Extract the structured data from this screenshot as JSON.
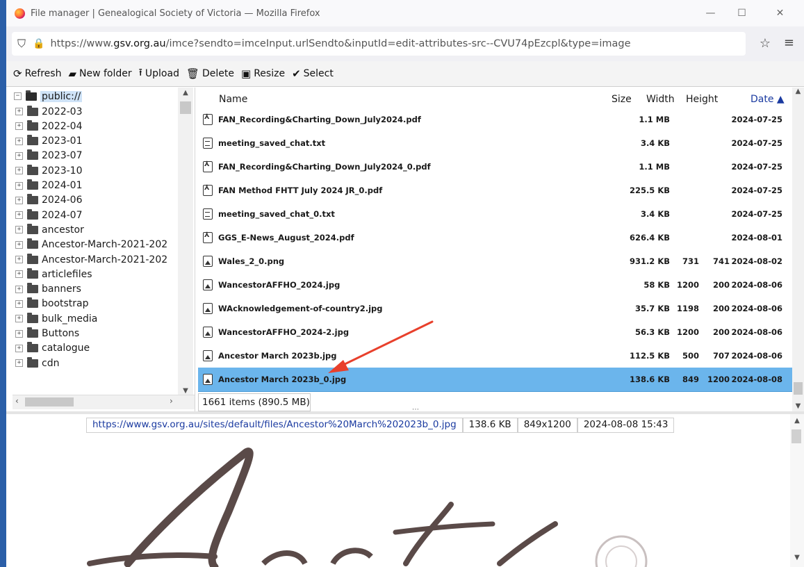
{
  "window": {
    "title": "File manager | Genealogical Society of Victoria — Mozilla Firefox",
    "controls": [
      "—",
      "☐",
      "✕"
    ]
  },
  "urlbar": {
    "url_prefix": "https://www.",
    "url_host": "gsv.org.au",
    "url_rest": "/imce?sendto=imceInput.urlSendto&inputId=edit-attributes-src--CVU74pEzcpl&type=image"
  },
  "toolbar": {
    "refresh": "Refresh",
    "new_folder": "New folder",
    "upload": "Upload",
    "delete": "Delete",
    "resize": "Resize",
    "select": "Select"
  },
  "tree": {
    "root": "public://",
    "folders": [
      "2022-03",
      "2022-04",
      "2023-01",
      "2023-07",
      "2023-10",
      "2024-01",
      "2024-06",
      "2024-07",
      "ancestor",
      "Ancestor-March-2021-202",
      "Ancestor-March-2021-202",
      "articlefiles",
      "banners",
      "bootstrap",
      "bulk_media",
      "Buttons",
      "catalogue",
      "cdn"
    ]
  },
  "list": {
    "headers": {
      "name": "Name",
      "size": "Size",
      "width": "Width",
      "height": "Height",
      "date": "Date ▲"
    },
    "files": [
      {
        "name": "FAN_Recording&Charting_Down_July2024.pdf",
        "size": "1.1 MB",
        "width": "",
        "height": "",
        "date": "2024-07-25",
        "type": "pdf"
      },
      {
        "name": "meeting_saved_chat.txt",
        "size": "3.4 KB",
        "width": "",
        "height": "",
        "date": "2024-07-25",
        "type": "txt"
      },
      {
        "name": "FAN_Recording&Charting_Down_July2024_0.pdf",
        "size": "1.1 MB",
        "width": "",
        "height": "",
        "date": "2024-07-25",
        "type": "pdf"
      },
      {
        "name": "FAN Method FHTT July 2024 JR_0.pdf",
        "size": "225.5 KB",
        "width": "",
        "height": "",
        "date": "2024-07-25",
        "type": "pdf"
      },
      {
        "name": "meeting_saved_chat_0.txt",
        "size": "3.4 KB",
        "width": "",
        "height": "",
        "date": "2024-07-25",
        "type": "txt"
      },
      {
        "name": "GGS_E-News_August_2024.pdf",
        "size": "626.4 KB",
        "width": "",
        "height": "",
        "date": "2024-08-01",
        "type": "pdf"
      },
      {
        "name": "Wales_2_0.png",
        "size": "931.2 KB",
        "width": "731",
        "height": "741",
        "date": "2024-08-02",
        "type": "img"
      },
      {
        "name": "WancestorAFFHO_2024.jpg",
        "size": "58 KB",
        "width": "1200",
        "height": "200",
        "date": "2024-08-06",
        "type": "img"
      },
      {
        "name": "WAcknowledgement-of-country2.jpg",
        "size": "35.7 KB",
        "width": "1198",
        "height": "200",
        "date": "2024-08-06",
        "type": "img"
      },
      {
        "name": "WancestorAFFHO_2024-2.jpg",
        "size": "56.3 KB",
        "width": "1200",
        "height": "200",
        "date": "2024-08-06",
        "type": "img"
      },
      {
        "name": "Ancestor March 2023b.jpg",
        "size": "112.5 KB",
        "width": "500",
        "height": "707",
        "date": "2024-08-06",
        "type": "img"
      },
      {
        "name": "Ancestor March 2023b_0.jpg",
        "size": "138.6 KB",
        "width": "849",
        "height": "1200",
        "date": "2024-08-08",
        "type": "img",
        "selected": true
      }
    ],
    "status": "1661 items (890.5 MB)"
  },
  "preview": {
    "url": "https://www.gsv.org.au/sites/default/files/Ancestor%20March%202023b_0.jpg",
    "size": "138.6 KB",
    "dimensions": "849x1200",
    "date": "2024-08-08 15:43"
  },
  "colors": {
    "selection": "#6bb5ec",
    "annotation_arrow": "#e8402c",
    "link": "#1a3aa0"
  }
}
